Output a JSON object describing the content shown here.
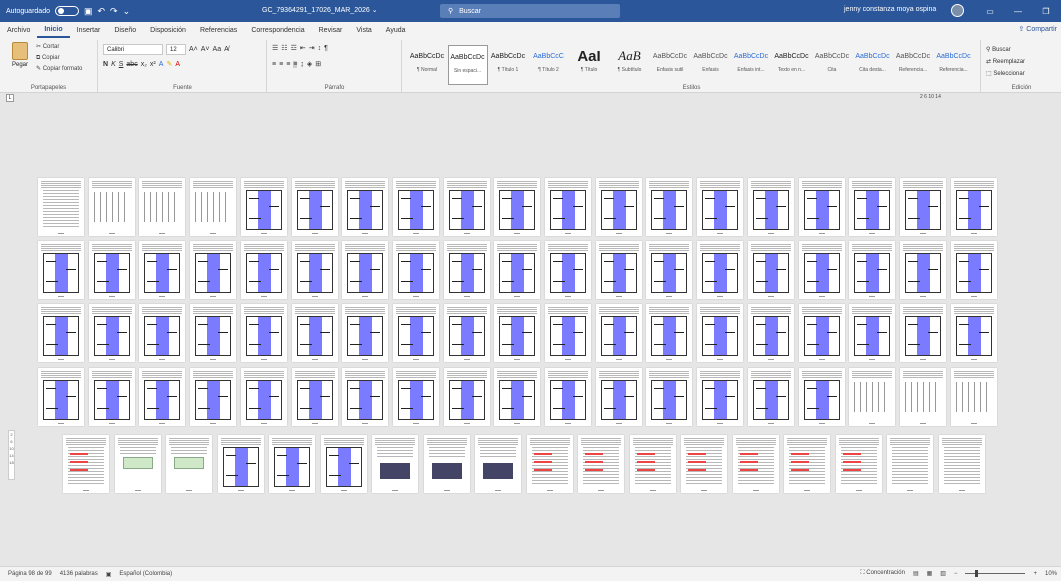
{
  "titlebar": {
    "autosave": "Autoguardado",
    "doc_title": "GC_79364291_17026_MAR_2026 ⌄",
    "search": "Buscar",
    "user": "jenny constanza moya ospina"
  },
  "menu": {
    "tabs": [
      "Archivo",
      "Inicio",
      "Insertar",
      "Diseño",
      "Disposición",
      "Referencias",
      "Correspondencia",
      "Revisar",
      "Vista",
      "Ayuda"
    ],
    "active": "Inicio",
    "share": "Compartir"
  },
  "ribbon": {
    "clipboard": {
      "paste": "Pegar",
      "cut": "Cortar",
      "copy": "Copiar",
      "format": "Copiar formato",
      "label": "Portapapeles"
    },
    "font": {
      "name": "Calibri",
      "size": "12",
      "label": "Fuente"
    },
    "paragraph": {
      "label": "Párrafo"
    },
    "styles": {
      "label": "Estilos",
      "items": [
        {
          "preview": "AaBbCcDc",
          "name": "¶ Normal"
        },
        {
          "preview": "AaBbCcDc",
          "name": "Sin espaci..."
        },
        {
          "preview": "AaBbCcDc",
          "name": "¶ Título 1"
        },
        {
          "preview": "AaBbCcC",
          "name": "¶ Título 2"
        },
        {
          "preview": "AaI",
          "name": "¶ Título"
        },
        {
          "preview": "AaB",
          "name": "¶ Subtítulo"
        },
        {
          "preview": "AaBbCcDc",
          "name": "Énfasis sutil"
        },
        {
          "preview": "AaBbCcDc",
          "name": "Énfasis"
        },
        {
          "preview": "AaBbCcDc",
          "name": "Énfasis int..."
        },
        {
          "preview": "AaBbCcDc",
          "name": "Texto en n..."
        },
        {
          "preview": "AaBbCcDc",
          "name": "Cita"
        },
        {
          "preview": "AaBbCcDc",
          "name": "Cita desta..."
        },
        {
          "preview": "AaBbCcDc",
          "name": "Referencia..."
        },
        {
          "preview": "AaBbCcDc",
          "name": "Referencia..."
        }
      ]
    },
    "editing": {
      "find": "Buscar",
      "replace": "Reemplazar",
      "select": "Seleccionar",
      "label": "Edición"
    }
  },
  "ruler": {
    "nums": "2  6  10  14"
  },
  "vruler": {
    "nums": "2 6 10 14 18"
  },
  "status": {
    "page": "Página 98 de 99",
    "words": "4136 palabras",
    "lang": "Español (Colombia)",
    "focus": "Concentración",
    "zoom": "10%"
  }
}
